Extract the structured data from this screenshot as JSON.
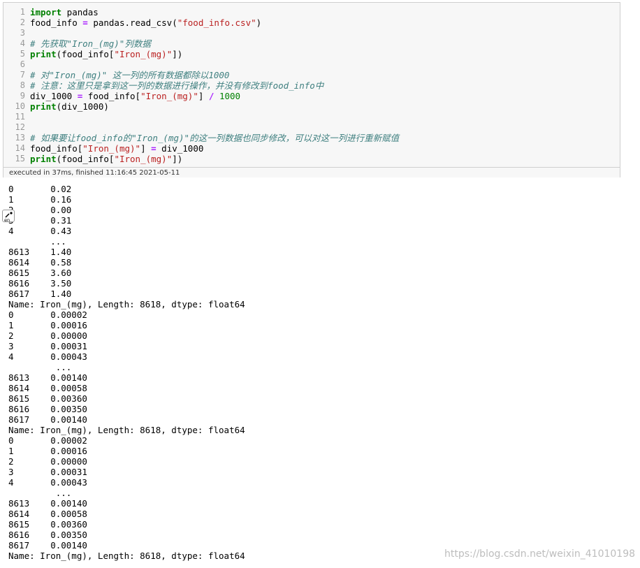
{
  "code_lines": [
    {
      "n": "1",
      "tokens": [
        {
          "t": "import",
          "c": "kw"
        },
        {
          "t": " pandas",
          "c": ""
        }
      ]
    },
    {
      "n": "2",
      "tokens": [
        {
          "t": "food_info ",
          "c": ""
        },
        {
          "t": "=",
          "c": "op"
        },
        {
          "t": " pandas.read_csv(",
          "c": ""
        },
        {
          "t": "\"food_info.csv\"",
          "c": "str"
        },
        {
          "t": ")",
          "c": ""
        }
      ]
    },
    {
      "n": "3",
      "tokens": []
    },
    {
      "n": "4",
      "tokens": [
        {
          "t": "# 先获取\"Iron_(mg)\"列数据",
          "c": "comment"
        }
      ]
    },
    {
      "n": "5",
      "tokens": [
        {
          "t": "print",
          "c": "kw"
        },
        {
          "t": "(food_info[",
          "c": ""
        },
        {
          "t": "\"Iron_(mg)\"",
          "c": "str"
        },
        {
          "t": "])",
          "c": ""
        }
      ]
    },
    {
      "n": "6",
      "tokens": []
    },
    {
      "n": "7",
      "tokens": [
        {
          "t": "# 对\"Iron_(mg)\" 这一列的所有数据都除以1000",
          "c": "comment"
        }
      ]
    },
    {
      "n": "8",
      "tokens": [
        {
          "t": "# 注意：这里只是拿到这一列的数据进行操作，并没有修改到food_info中",
          "c": "comment"
        }
      ]
    },
    {
      "n": "9",
      "tokens": [
        {
          "t": "div_1000 ",
          "c": ""
        },
        {
          "t": "=",
          "c": "op"
        },
        {
          "t": " food_info[",
          "c": ""
        },
        {
          "t": "\"Iron_(mg)\"",
          "c": "str"
        },
        {
          "t": "] ",
          "c": ""
        },
        {
          "t": "/",
          "c": "op"
        },
        {
          "t": " ",
          "c": ""
        },
        {
          "t": "1000",
          "c": "num"
        }
      ]
    },
    {
      "n": "10",
      "tokens": [
        {
          "t": "print",
          "c": "kw"
        },
        {
          "t": "(div_1000)",
          "c": ""
        }
      ]
    },
    {
      "n": "11",
      "tokens": []
    },
    {
      "n": "12",
      "tokens": []
    },
    {
      "n": "13",
      "tokens": [
        {
          "t": "# 如果要让food_info的\"Iron_(mg)\"的这一列数据也同步修改，可以对这一列进行重新赋值",
          "c": "comment"
        }
      ]
    },
    {
      "n": "14",
      "tokens": [
        {
          "t": "food_info[",
          "c": ""
        },
        {
          "t": "\"Iron_(mg)\"",
          "c": "str"
        },
        {
          "t": "] ",
          "c": ""
        },
        {
          "t": "=",
          "c": "op"
        },
        {
          "t": " div_1000",
          "c": ""
        }
      ]
    },
    {
      "n": "15",
      "tokens": [
        {
          "t": "print",
          "c": "kw"
        },
        {
          "t": "(food_info[",
          "c": ""
        },
        {
          "t": "\"Iron_(mg)\"",
          "c": "str"
        },
        {
          "t": "])",
          "c": ""
        }
      ]
    }
  ],
  "exec_status": "executed in 37ms, finished 11:16:45 2021-05-11",
  "output_lines": [
    "0       0.02",
    "1       0.16",
    "2       0.00",
    "3       0.31",
    "4       0.43",
    "        ...",
    "8613    1.40",
    "8614    0.58",
    "8615    3.60",
    "8616    3.50",
    "8617    1.40",
    "Name: Iron_(mg), Length: 8618, dtype: float64",
    "0       0.00002",
    "1       0.00016",
    "2       0.00000",
    "3       0.00031",
    "4       0.00043",
    "         ...",
    "8613    0.00140",
    "8614    0.00058",
    "8615    0.00360",
    "8616    0.00350",
    "8617    0.00140",
    "Name: Iron_(mg), Length: 8618, dtype: float64",
    "0       0.00002",
    "1       0.00016",
    "2       0.00000",
    "3       0.00031",
    "4       0.00043",
    "         ...",
    "8613    0.00140",
    "8614    0.00058",
    "8615    0.00360",
    "8616    0.00350",
    "8617    0.00140",
    "Name: Iron_(mg), Length: 8618, dtype: float64"
  ],
  "lang_icon": {
    "name": "language-switch-icon",
    "label": "en"
  },
  "watermark": "https://blog.csdn.net/weixin_41010198"
}
